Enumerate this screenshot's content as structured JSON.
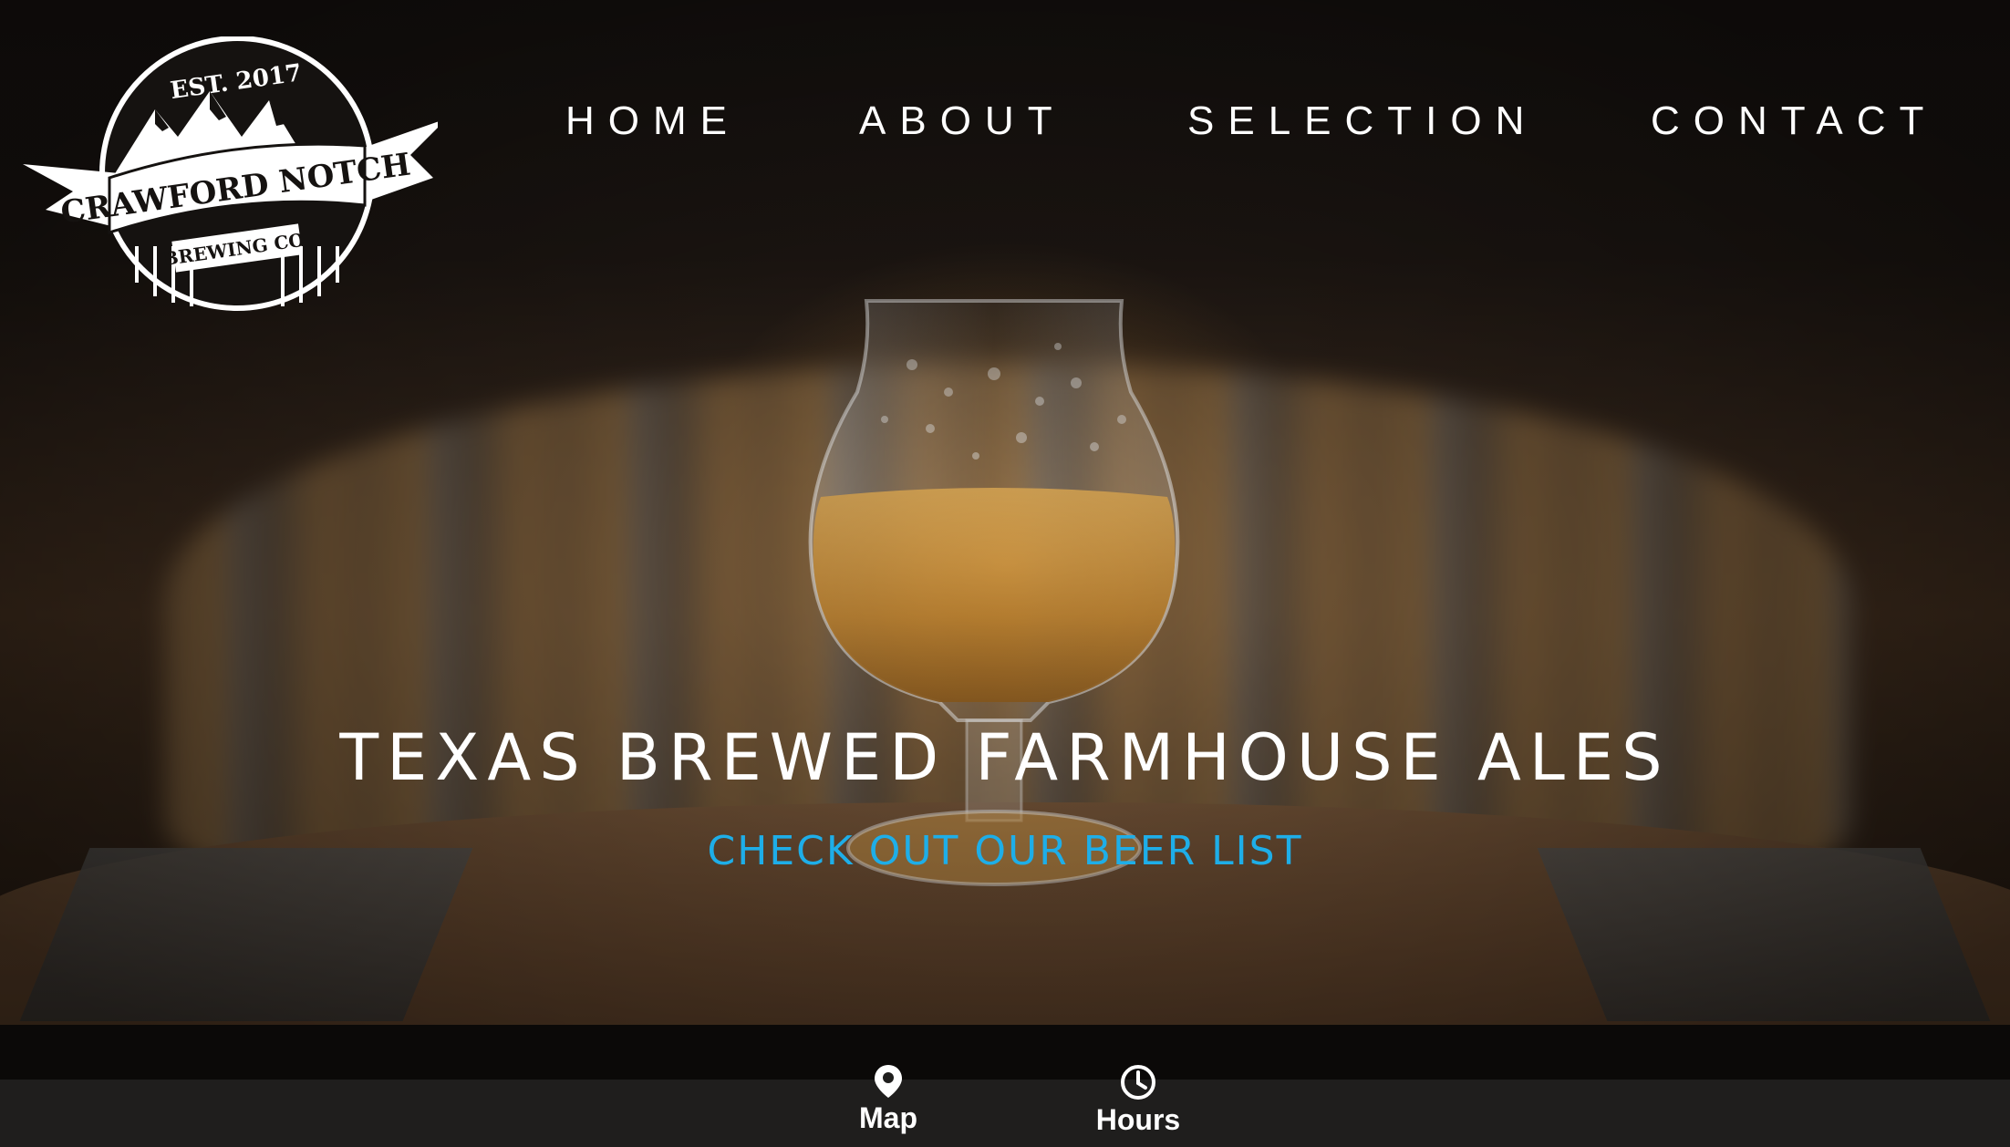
{
  "logo": {
    "established": "EST. 2017",
    "name": "CRAWFORD NOTCH",
    "sub": "BREWING CO."
  },
  "nav": {
    "items": [
      {
        "label": "HOME"
      },
      {
        "label": "ABOUT"
      },
      {
        "label": "SELECTION"
      },
      {
        "label": "CONTACT"
      }
    ]
  },
  "hero": {
    "headline": "TEXAS BREWED FARMHOUSE ALES",
    "cta": "CHECK OUT OUR BEER LIST"
  },
  "bottom_bar": {
    "map_label": "Map",
    "map_icon": "map-pin-icon",
    "hours_label": "Hours",
    "hours_icon": "clock-icon"
  },
  "colors": {
    "cta": "#1eaee8",
    "bottom_bar": "#1f1e1d",
    "text": "#ffffff"
  }
}
